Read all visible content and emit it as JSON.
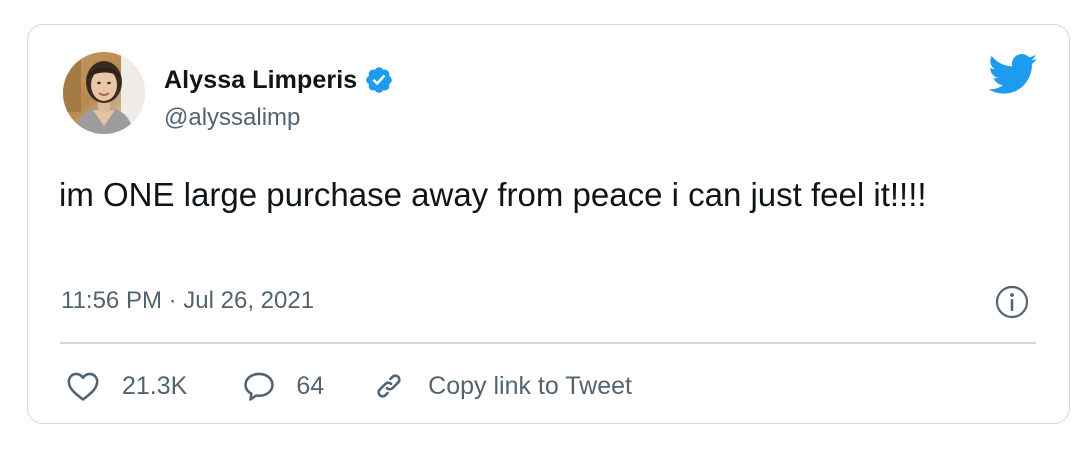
{
  "tweet": {
    "author": {
      "display_name": "Alyssa Limperis",
      "handle": "@alyssalimp",
      "verified": true
    },
    "text": "im ONE large purchase away from peace i can just feel it!!!!",
    "timestamp": "11:56 PM · Jul 26, 2021",
    "actions": {
      "like_count": "21.3K",
      "reply_count": "64",
      "copy_link_label": "Copy link to Tweet"
    }
  },
  "icons": {
    "brand": "twitter-bird-icon",
    "verified": "verified-badge-icon",
    "info": "info-icon",
    "like": "heart-icon",
    "reply": "speech-bubble-icon",
    "copy": "link-icon"
  },
  "colors": {
    "brand_blue": "#1d9bf0",
    "text_primary": "#0f1419",
    "text_secondary": "#536471",
    "border": "#cfd9de"
  }
}
